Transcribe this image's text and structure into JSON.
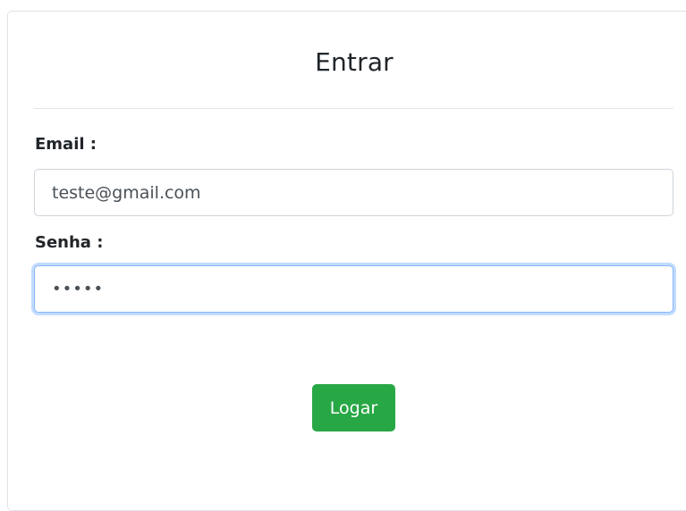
{
  "form": {
    "title": "Entrar",
    "email": {
      "label": "Email :",
      "value": "teste@gmail.com"
    },
    "password": {
      "label": "Senha :",
      "value": "•••••"
    },
    "submit_label": "Logar"
  },
  "colors": {
    "button": "#28a745",
    "focus_border": "#86b7fe"
  }
}
